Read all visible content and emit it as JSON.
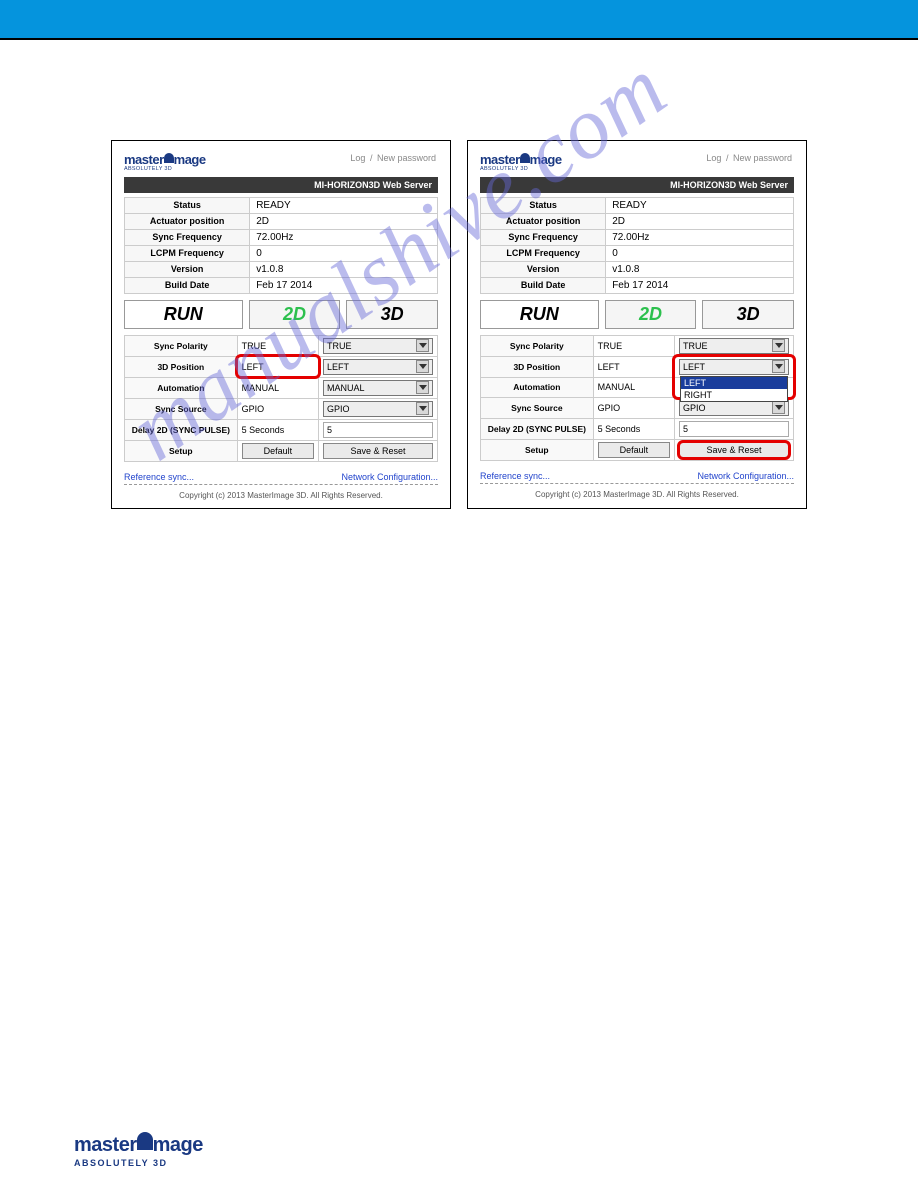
{
  "header": {
    "log": "Log",
    "sep": "/",
    "newpw": "New password",
    "title": "MI-HORIZON3D Web Server"
  },
  "logo": {
    "part1": "master",
    "part2": "mage",
    "tagline": "ABSOLUTELY 3D"
  },
  "status": {
    "status_label": "Status",
    "status": "READY",
    "actpos_label": "Actuator position",
    "actpos": "2D",
    "syncfreq_label": "Sync Frequency",
    "syncfreq": "72.00Hz",
    "lcpmfreq_label": "LCPM Frequency",
    "lcpmfreq": "0",
    "version_label": "Version",
    "version": "v1.0.8",
    "builddate_label": "Build Date",
    "builddate": "Feb 17 2014"
  },
  "buttons": {
    "run": "RUN",
    "twod": "2D",
    "threed": "3D"
  },
  "settings": {
    "sync_polarity_label": "Sync Polarity",
    "sync_polarity_val": "TRUE",
    "sync_polarity_sel": "TRUE",
    "threed_pos_label": "3D Position",
    "threed_pos_val": "LEFT",
    "threed_pos_sel": "LEFT",
    "threed_pos_options": [
      "LEFT",
      "RIGHT"
    ],
    "automation_label": "Automation",
    "automation_val": "MANUAL",
    "automation_sel": "MANUAL",
    "sync_source_label": "Sync Source",
    "sync_source_val": "GPIO",
    "sync_source_sel": "GPIO",
    "delay2d_label": "Delay 2D (SYNC PULSE)",
    "delay2d_val": "5 Seconds",
    "delay2d_input": "5",
    "setup_label": "Setup",
    "default_btn": "Default",
    "save_reset_btn": "Save & Reset"
  },
  "links": {
    "ref_sync": "Reference sync...",
    "net_config": "Network Configuration..."
  },
  "copyright": "Copyright (c) 2013 MasterImage 3D. All Rights Reserved.",
  "watermark": "manualshive.com",
  "footer_logo_tag_bold": "3D"
}
